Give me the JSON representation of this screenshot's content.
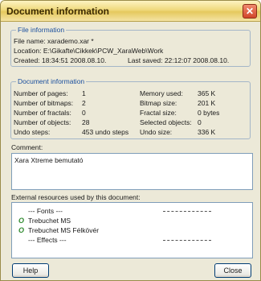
{
  "window": {
    "title": "Document information",
    "close_glyph": "✕"
  },
  "file_info": {
    "group_title": "File information",
    "file_name": "File name: xarademo.xar *",
    "location": "Location:  E:\\Gikafte\\Cikkek\\PCW_XaraWeb\\Work",
    "created": "Created:   18:34:51  2008.08.10.",
    "last_saved": "Last saved:  22:12:07  2008.08.10."
  },
  "doc_info": {
    "group_title": "Document information",
    "rows": [
      {
        "label": "Number of pages:",
        "value": "1",
        "label2": "Memory used:",
        "value2": "365 K"
      },
      {
        "label": "Number of bitmaps:",
        "value": "2",
        "label2": "Bitmap size:",
        "value2": "201 K"
      },
      {
        "label": "Number of fractals:",
        "value": "0",
        "label2": "Fractal size:",
        "value2": "0 bytes"
      },
      {
        "label": "Number of objects:",
        "value": "28",
        "label2": "Selected objects:",
        "value2": "0"
      },
      {
        "label": "Undo steps:",
        "value": "453 undo steps",
        "label2": "Undo size:",
        "value2": "336 K"
      }
    ]
  },
  "comment": {
    "label": "Comment:",
    "text": "Xara Xtreme bemutató"
  },
  "external": {
    "label": "External resources used by this document:",
    "fonts_header": "--- Fonts ---",
    "fonts": [
      "Trebuchet MS",
      "Trebuchet MS Félkövér"
    ],
    "effects_header": "--- Effects ---",
    "font_icon": "truetype-font-icon"
  },
  "buttons": {
    "help": "Help",
    "close": "Close"
  }
}
